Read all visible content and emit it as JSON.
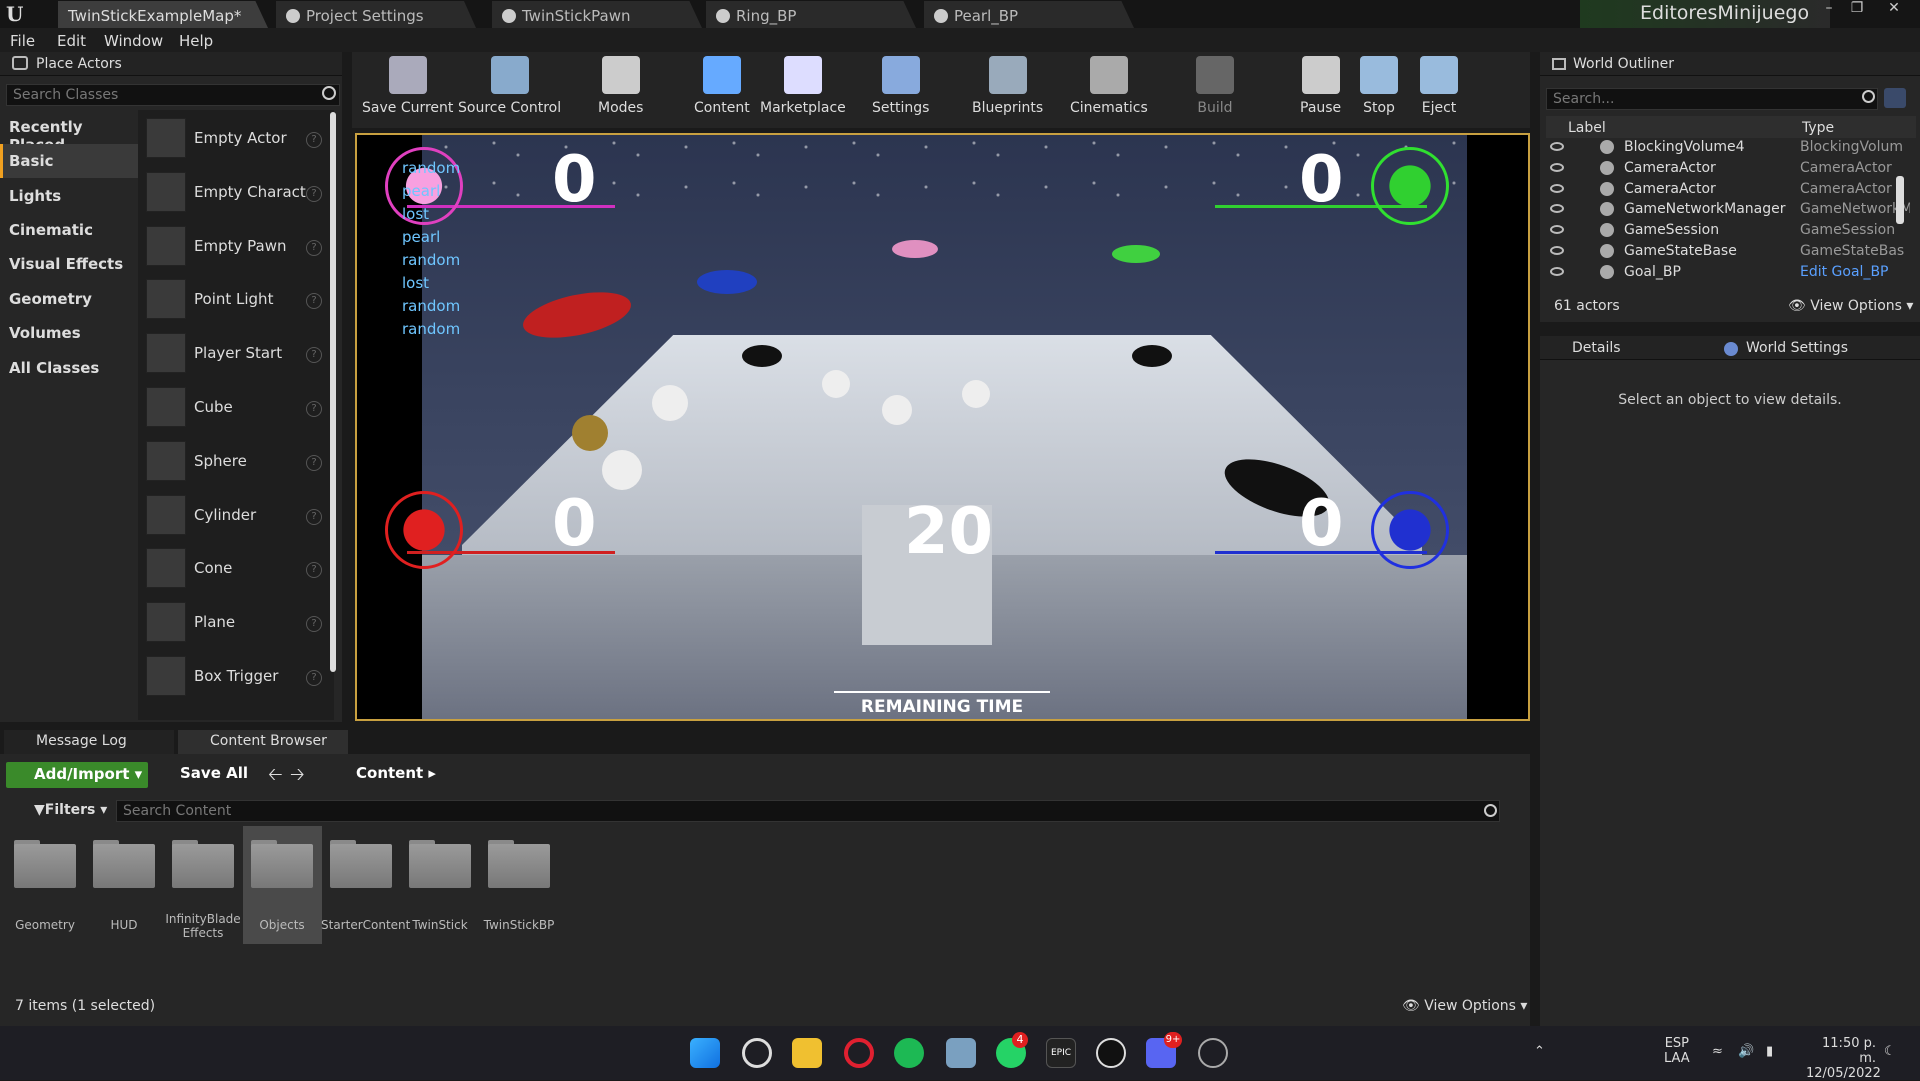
{
  "titlebar": {
    "tabs": [
      "TwinStickExampleMap*",
      "Project Settings",
      "TwinStickPawn",
      "Ring_BP",
      "Pearl_BP"
    ],
    "project_name": "EditoresMinijuego"
  },
  "menu": [
    "File",
    "Edit",
    "Window",
    "Help"
  ],
  "place_actors": {
    "title": "Place Actors",
    "search_placeholder": "Search Classes",
    "categories": [
      "Recently Placed",
      "Basic",
      "Lights",
      "Cinematic",
      "Visual Effects",
      "Geometry",
      "Volumes",
      "All Classes"
    ],
    "selected_category": "Basic",
    "items": [
      "Empty Actor",
      "Empty Characte",
      "Empty Pawn",
      "Point Light",
      "Player Start",
      "Cube",
      "Sphere",
      "Cylinder",
      "Cone",
      "Plane",
      "Box Trigger"
    ]
  },
  "toolbar": {
    "buttons": [
      "Save Current",
      "Source Control",
      "Modes",
      "Content",
      "Marketplace",
      "Settings",
      "Blueprints",
      "Cinematics",
      "Build",
      "Pause",
      "Stop",
      "Eject"
    ]
  },
  "viewport": {
    "scores": {
      "top_left": "0",
      "top_right": "0",
      "bottom_left": "0",
      "bottom_right": "0"
    },
    "timer": "20",
    "timer_label": "REMAINING TIME",
    "feed": [
      "random",
      "pearl",
      "lost",
      "pearl",
      "random",
      "lost",
      "random",
      "random"
    ],
    "player_colors": {
      "pink": "#e040c0",
      "green": "#30e030",
      "red": "#e02020",
      "blue": "#2030e0"
    }
  },
  "outliner": {
    "title": "World Outliner",
    "search_placeholder": "Search...",
    "col_label": "Label",
    "col_type": "Type",
    "rows": [
      {
        "label": "BlockingVolume4",
        "type": "BlockingVolum"
      },
      {
        "label": "CameraActor",
        "type": "CameraActor"
      },
      {
        "label": "CameraActor",
        "type": "CameraActor"
      },
      {
        "label": "GameNetworkManager",
        "type": "GameNetworkM"
      },
      {
        "label": "GameSession",
        "type": "GameSession"
      },
      {
        "label": "GameStateBase",
        "type": "GameStateBas"
      },
      {
        "label": "Goal_BP",
        "type": "Edit Goal_BP"
      }
    ],
    "count": "61 actors",
    "view_options": "View Options"
  },
  "details": {
    "tab_details": "Details",
    "tab_world_settings": "World Settings",
    "empty_message": "Select an object to view details."
  },
  "bottom_tabs": [
    "Message Log",
    "Content Browser"
  ],
  "content_browser": {
    "add_import": "Add/Import",
    "save_all": "Save All",
    "path": "Content",
    "filters": "Filters",
    "search_placeholder": "Search Content",
    "folders": [
      "Geometry",
      "HUD",
      "InfinityBlade Effects",
      "Objects",
      "StarterContent",
      "TwinStick",
      "TwinStickBP"
    ],
    "selected_folder": "Objects",
    "status": "7 items (1 selected)",
    "view_options": "View Options"
  },
  "taskbar": {
    "language": "ESP",
    "language_sub": "LAA",
    "time": "11:50 p. m.",
    "date": "12/05/2022",
    "whatsapp_badge": "4",
    "discord_badge": "9+"
  }
}
